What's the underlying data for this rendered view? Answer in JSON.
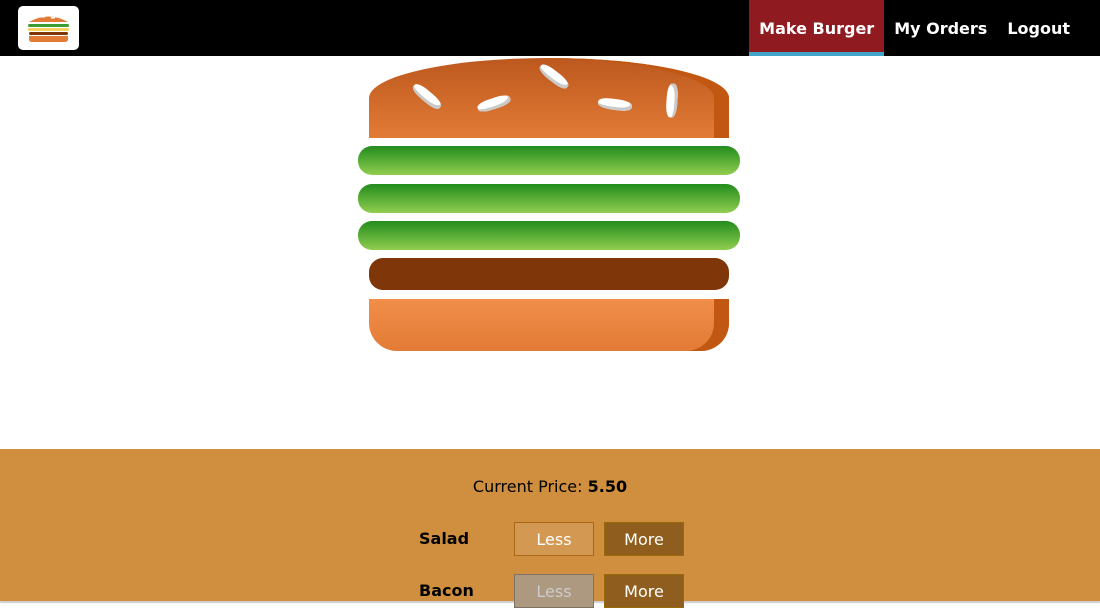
{
  "nav": {
    "items": [
      {
        "label": "Make Burger",
        "active": true
      },
      {
        "label": "My Orders",
        "active": false
      },
      {
        "label": "Logout",
        "active": false
      }
    ]
  },
  "logo": {
    "icon": "burger-logo-icon"
  },
  "burger": {
    "layers": [
      "bread-top",
      "salad",
      "salad",
      "salad",
      "meat",
      "bread-bottom"
    ]
  },
  "build_controls": {
    "price_label": "Current Price:",
    "price_value": "5.50",
    "controls": [
      {
        "label": "Salad",
        "less_label": "Less",
        "more_label": "More",
        "less_disabled": false
      },
      {
        "label": "Bacon",
        "less_label": "Less",
        "more_label": "More",
        "less_disabled": true
      }
    ]
  },
  "colors": {
    "toolbar": "#000000",
    "active_nav": "#8f1a1f",
    "active_nav_underline": "#40a4c8",
    "controls_bg": "#cf8f3e",
    "more_button": "#8f5e1e",
    "less_button": "#d39952",
    "less_disabled": "#ac9980",
    "bread": "#e27b36",
    "salad": "#228c1d",
    "meat": "#7f3608"
  }
}
